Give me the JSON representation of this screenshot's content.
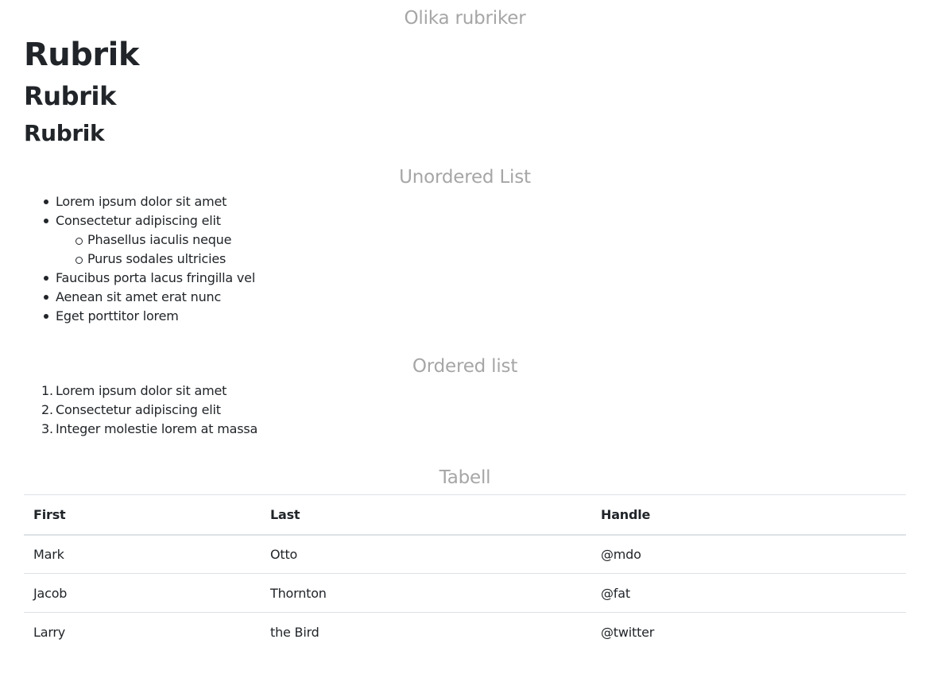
{
  "headings_section": {
    "title": "Olika rubriker",
    "h1": "Rubrik",
    "h2": "Rubrik",
    "h3": "Rubrik"
  },
  "unordered_section": {
    "title": "Unordered List",
    "items": [
      "Lorem ipsum dolor sit amet",
      "Consectetur adipiscing elit",
      "Faucibus porta lacus fringilla vel",
      "Aenean sit amet erat nunc",
      "Eget porttitor lorem"
    ],
    "sub_items": [
      "Phasellus iaculis neque",
      "Purus sodales ultricies"
    ]
  },
  "ordered_section": {
    "title": "Ordered list",
    "markers": [
      "1.",
      "2.",
      "3."
    ],
    "items": [
      "Lorem ipsum dolor sit amet",
      "Consectetur adipiscing elit",
      "Integer molestie lorem at massa"
    ]
  },
  "table_section": {
    "title": "Tabell",
    "headers": [
      "First",
      "Last",
      "Handle"
    ],
    "rows": [
      [
        "Mark",
        "Otto",
        "@mdo"
      ],
      [
        "Jacob",
        "Thornton",
        "@fat"
      ],
      [
        "Larry",
        "the Bird",
        "@twitter"
      ]
    ]
  }
}
